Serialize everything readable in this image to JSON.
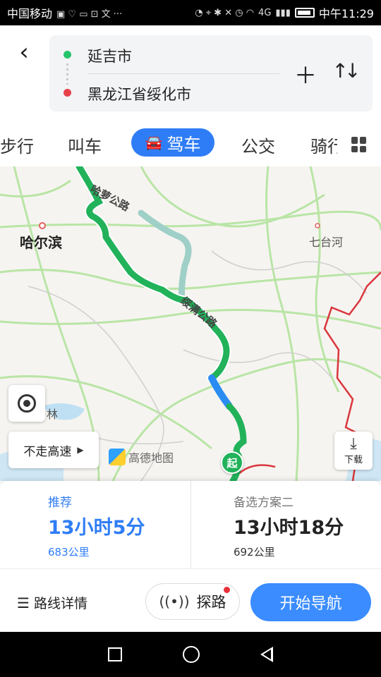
{
  "status_bar": {
    "carrier": "中国移动",
    "clock": "中午11:29",
    "network": "4G"
  },
  "route": {
    "start": "延吉市",
    "end": "黑龙江省绥化市"
  },
  "tabs": {
    "walk": "步行",
    "taxi": "叫车",
    "drive": "驾车",
    "bus": "公交",
    "bike": "骑行"
  },
  "map": {
    "city_harbin": "哈尔滨",
    "city_qitaihe": "七台河",
    "city_lin": "林",
    "road_1": "哈萝公路",
    "road_2": "绥满公路",
    "start_marker": "起",
    "no_highway": "不走高速",
    "logo": "高德地图",
    "download": "下载"
  },
  "plans": [
    {
      "tag": "推荐",
      "time": "13小时5分",
      "distance": "683公里"
    },
    {
      "tag": "备选方案二",
      "time": "13小时18分",
      "distance": "692公里"
    }
  ],
  "actions": {
    "route_detail": "路线详情",
    "explore": "探路",
    "start_nav": "开始导航"
  },
  "colors": {
    "accent": "#2f7df6",
    "route_green": "#21b25a",
    "route_blue": "#2a8cf2",
    "route_alt": "#9fd0c8",
    "border_red": "#d9363e"
  }
}
